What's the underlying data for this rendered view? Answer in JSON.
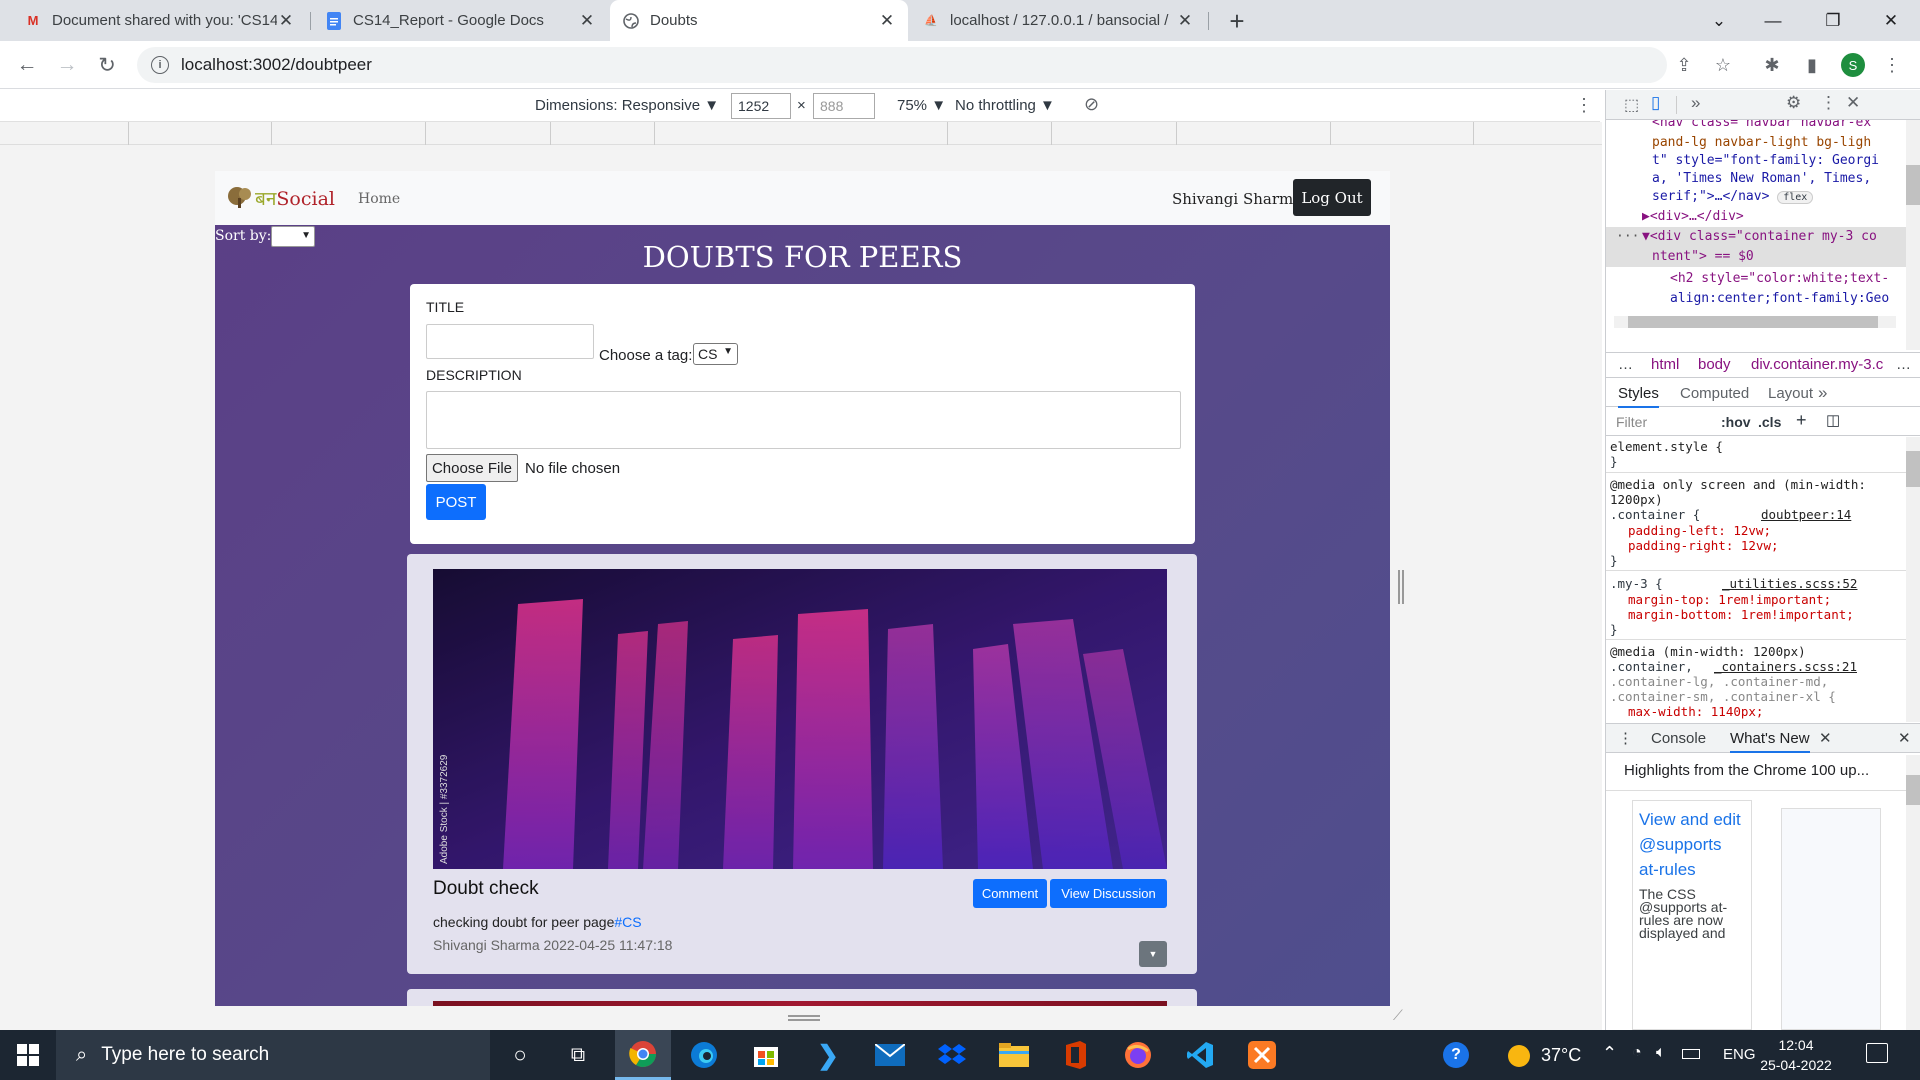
{
  "browser": {
    "tabs": [
      {
        "title": "Document shared with you: 'CS14",
        "icon": "gmail-icon",
        "active": false
      },
      {
        "title": "CS14_Report - Google Docs",
        "icon": "docs-icon",
        "active": false
      },
      {
        "title": "Doubts",
        "icon": "globe-icon",
        "active": true
      },
      {
        "title": "localhost / 127.0.0.1 / bansocial /",
        "icon": "phpmyadmin-icon",
        "active": false
      }
    ],
    "new_tab": "+",
    "url": "localhost:3002/doubtpeer",
    "profile_initial": "S"
  },
  "device_toolbar": {
    "dimensions": "Dimensions: Responsive ▼",
    "width": "1252",
    "times": "×",
    "height_placeholder": "888",
    "zoom": "75% ▼",
    "throttling": "No throttling ▼"
  },
  "site": {
    "brand_hindi": "बन",
    "brand_text": "Social",
    "nav_home": "Home",
    "user_name": "Shivangi Sharma",
    "logout": "Log Out",
    "sort_label": "Sort by:",
    "heading": "DOUBTS FOR PEERS",
    "form": {
      "title_label": "TITLE",
      "tag_label": "Choose a tag:",
      "tag_value": "CS",
      "description_label": "DESCRIPTION",
      "file_button": "Choose File",
      "file_status": "No file chosen",
      "post_button": "POST"
    },
    "post": {
      "image_watermark": "Adobe Stock | #3372629",
      "title": "Doubt check",
      "comment_button": "Comment",
      "view_button": "View Discussion",
      "body": "checking doubt for peer page",
      "tag": "#CS",
      "meta": "Shivangi Sharma 2022-04-25 11:47:18"
    }
  },
  "devtools": {
    "dom_lines": [
      {
        "pre": "<nav class=\"navbar navbar-ex",
        "cls": "cut"
      },
      {
        "pre": "pand-lg navbar-light bg-ligh"
      },
      {
        "pre": "t\" style=\"font-family: Georgi"
      },
      {
        "pre": "a, 'Times New Roman', Times,"
      },
      {
        "pre": "serif;\">…</nav>",
        "badge": "flex"
      },
      {
        "pre": "▶<div>…</div>"
      },
      {
        "pre": "▼<div class=\"container my-3 co"
      },
      {
        "pre": "ntent\"> == $0"
      },
      {
        "pre": "<h2 style=\"color:white;text-"
      },
      {
        "pre": "align:center;font-family:Geo"
      }
    ],
    "breadcrumbs": [
      "…",
      "html",
      "body",
      "div.container.my-3.c",
      "…"
    ],
    "panel_tabs": [
      "Styles",
      "Computed",
      "Layout",
      "»"
    ],
    "filter_placeholder": "Filter",
    "hov": ":hov",
    "cls": ".cls",
    "rules": [
      {
        "selector": "element.style {",
        "lines": [
          "}"
        ]
      },
      {
        "selector": "@media only screen and (min-width: 1200px)",
        "sub": ".container {",
        "source": "doubtpeer:14",
        "lines": [
          "padding-left: 12vw;",
          "padding-right: 12vw;",
          "}"
        ]
      },
      {
        "selector": ".my-3 {",
        "source": "_utilities.scss:52",
        "lines": [
          "margin-top: 1rem!important;",
          "margin-bottom: 1rem!important;",
          "}"
        ]
      },
      {
        "selector": "@media (min-width: 1200px)",
        "sub": ".container,",
        "source": "_containers.scss:21",
        "lines": [
          ".container-lg, .container-md,",
          ".container-sm, .container-xl {",
          "max-width: 1140px;"
        ]
      }
    ],
    "drawer_tabs": [
      "Console",
      "What's New"
    ],
    "whats_new_header": "Highlights from the Chrome 100 up...",
    "whats_new_title": "View and edit @supports at-rules",
    "whats_new_body": "The CSS @supports at-rules are now displayed and"
  },
  "taskbar": {
    "search_placeholder": "Type here to search",
    "temperature": "37°C",
    "language": "ENG",
    "time": "12:04",
    "date": "25-04-2022"
  }
}
